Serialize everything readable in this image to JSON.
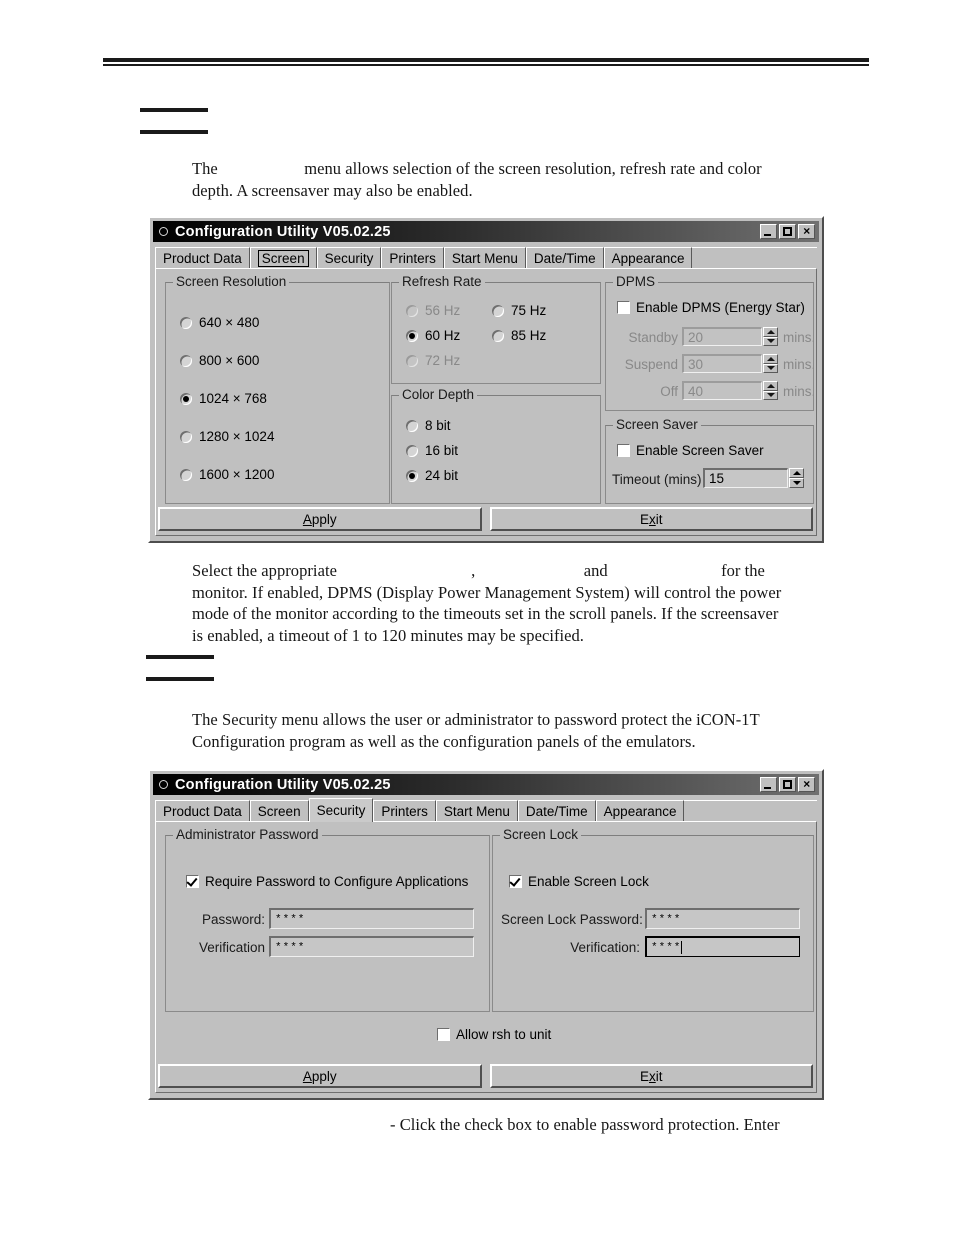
{
  "document": {
    "section1": {
      "paragraph_lead": "The",
      "paragraph_blank": "",
      "paragraph_rest": "menu allows selection of the screen resolution, refresh rate and color depth. A screensaver may also be enabled."
    },
    "caption1_line1_a": "Select the appropriate",
    "caption1_line1_b": ",",
    "caption1_line1_c": "and",
    "caption1_line1_d": "for the",
    "caption1_rest": "monitor. If enabled, DPMS (Display Power Management System) will control the power mode of the monitor according to the timeouts set in the scroll panels.  If the screensaver is enabled, a timeout of 1 to 120 minutes may be specified.",
    "section2": {
      "paragraph": "The Security menu allows the user or administrator to password protect the iCON-1T Configuration program as well as the configuration panels of the emulators."
    },
    "footer_line": "- Click the check box to enable password protection. Enter"
  },
  "window_screen": {
    "title": "Configuration Utility V05.02.25",
    "title_buttons": {
      "minimize": "minimize-icon",
      "maximize": "maximize-icon",
      "close": "×"
    },
    "tabs": [
      {
        "label": "Product Data",
        "state": "normal"
      },
      {
        "label": "Screen",
        "state": "focused"
      },
      {
        "label": "Security",
        "state": "normal"
      },
      {
        "label": "Printers",
        "state": "normal"
      },
      {
        "label": "Start Menu",
        "state": "normal"
      },
      {
        "label": "Date/Time",
        "state": "normal"
      },
      {
        "label": "Appearance",
        "state": "normal"
      }
    ],
    "screen_resolution": {
      "legend": "Screen Resolution",
      "options": [
        {
          "label": "640 × 480",
          "selected": false
        },
        {
          "label": "800 × 600",
          "selected": false
        },
        {
          "label": "1024 × 768",
          "selected": true
        },
        {
          "label": "1280 × 1024",
          "selected": false
        },
        {
          "label": "1600 × 1200",
          "selected": false
        }
      ]
    },
    "refresh_rate": {
      "legend": "Refresh Rate",
      "options": [
        {
          "label": "56 Hz",
          "selected": false,
          "disabled": true
        },
        {
          "label": "60 Hz",
          "selected": true,
          "disabled": false
        },
        {
          "label": "72 Hz",
          "selected": false,
          "disabled": true
        },
        {
          "label": "75 Hz",
          "selected": false,
          "disabled": false
        },
        {
          "label": "85 Hz",
          "selected": false,
          "disabled": false
        }
      ]
    },
    "color_depth": {
      "legend": "Color Depth",
      "options": [
        {
          "label": "8 bit",
          "selected": false
        },
        {
          "label": "16 bit",
          "selected": false
        },
        {
          "label": "24 bit",
          "selected": true
        }
      ]
    },
    "dpms": {
      "legend": "DPMS",
      "enable_label": "Enable DPMS (Energy Star)",
      "enabled": false,
      "rows": [
        {
          "label": "Standby",
          "value": "20",
          "unit": "mins.",
          "disabled": true
        },
        {
          "label": "Suspend",
          "value": "30",
          "unit": "mins.",
          "disabled": true
        },
        {
          "label": "Off",
          "value": "40",
          "unit": "mins.",
          "disabled": true
        }
      ]
    },
    "screen_saver": {
      "legend": "Screen Saver",
      "enable_label": "Enable Screen Saver",
      "enabled": false,
      "timeout_label": "Timeout (mins)",
      "timeout_value": "15"
    },
    "buttons": {
      "apply": "Apply",
      "exit": "Exit"
    }
  },
  "window_security": {
    "title": "Configuration Utility V05.02.25",
    "tabs": [
      {
        "label": "Product Data",
        "state": "normal"
      },
      {
        "label": "Screen",
        "state": "normal"
      },
      {
        "label": "Security",
        "state": "active"
      },
      {
        "label": "Printers",
        "state": "normal"
      },
      {
        "label": "Start Menu",
        "state": "normal"
      },
      {
        "label": "Date/Time",
        "state": "normal"
      },
      {
        "label": "Appearance",
        "state": "normal"
      }
    ],
    "admin_password": {
      "legend": "Administrator Password",
      "require_label": "Require Password to Configure Applications",
      "require_checked": true,
      "password_label": "Password:",
      "password_value": "****",
      "verification_label": "Verification",
      "verification_value": "****"
    },
    "screen_lock": {
      "legend": "Screen Lock",
      "enable_label": "Enable Screen Lock",
      "enabled": true,
      "password_label": "Screen Lock Password:",
      "password_value": "****",
      "verification_label": "Verification:",
      "verification_value": "****"
    },
    "allow_rsh": {
      "label": "Allow rsh to unit",
      "checked": false
    },
    "buttons": {
      "apply": "Apply",
      "exit": "Exit"
    }
  },
  "colors": {
    "window_face": "#c0c0c0",
    "titlebar_dark": "#000000",
    "titlebar_light": "#707070",
    "text": "#000000",
    "disabled_text": "#888888",
    "page_background": "#ffffff",
    "rule": "#1a1a1a"
  }
}
